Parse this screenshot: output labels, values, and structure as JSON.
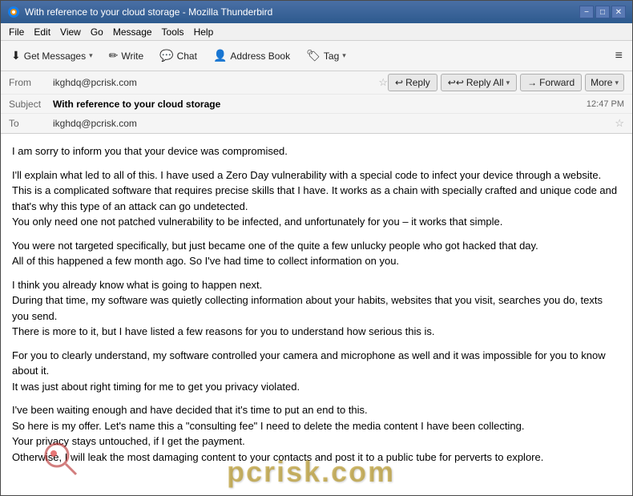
{
  "window": {
    "title": "With reference to your cloud storage - Mozilla Thunderbird",
    "controls": {
      "minimize": "−",
      "maximize": "□",
      "close": "✕"
    }
  },
  "menu": {
    "items": [
      "File",
      "Edit",
      "View",
      "Go",
      "Message",
      "Tools",
      "Help"
    ]
  },
  "toolbar": {
    "get_messages_label": "Get Messages",
    "write_label": "Write",
    "chat_label": "Chat",
    "address_book_label": "Address Book",
    "tag_label": "Tag",
    "hamburger": "≡"
  },
  "email_header": {
    "from_label": "From",
    "from_value": "ikghdq@pcrisk.com",
    "subject_label": "Subject",
    "subject_value": "With reference to your cloud storage",
    "to_label": "To",
    "to_value": "ikghdq@pcrisk.com",
    "timestamp": "12:47 PM",
    "actions": {
      "reply": "Reply",
      "reply_all": "Reply All",
      "forward": "Forward",
      "more": "More"
    }
  },
  "email_body": {
    "paragraphs": [
      "I am sorry to inform you that your device was compromised.",
      "I'll explain what led to all of this. I have used a Zero Day vulnerability with a special code to infect your device through a website.\nThis is a complicated software that requires precise skills that I have. It works as a chain with specially crafted and unique code and that's why this type of an attack can go undetected.\nYou only need one not patched vulnerability to be infected, and unfortunately for you – it works that simple.",
      "You were not targeted specifically, but just became one of the quite a few unlucky people who got hacked that day.\nAll of this happened a few month ago. So I've had time to collect information on you.",
      "I think you already know what is going to happen next.\nDuring that time, my software was quietly collecting information about your habits, websites that you visit, searches you do, texts you send.\nThere is more to it, but I have listed a few reasons for you to understand how serious this is.",
      "For you to clearly understand, my software controlled your camera and microphone as well and it was impossible for you to know about it.\nIt was just about right timing for me to get you privacy violated.",
      "I've been waiting enough and have decided that it's time to put an end to this.\nSo here is my offer. Let's name this a \"consulting fee\" I need to delete the media content I have been collecting.\nYour privacy stays untouched, if I get the payment.\nOtherwise, I will leak the most damaging content to your contacts and post it to a public tube for perverts to explore."
    ]
  },
  "watermark": {
    "text": "pcrisk.com"
  }
}
